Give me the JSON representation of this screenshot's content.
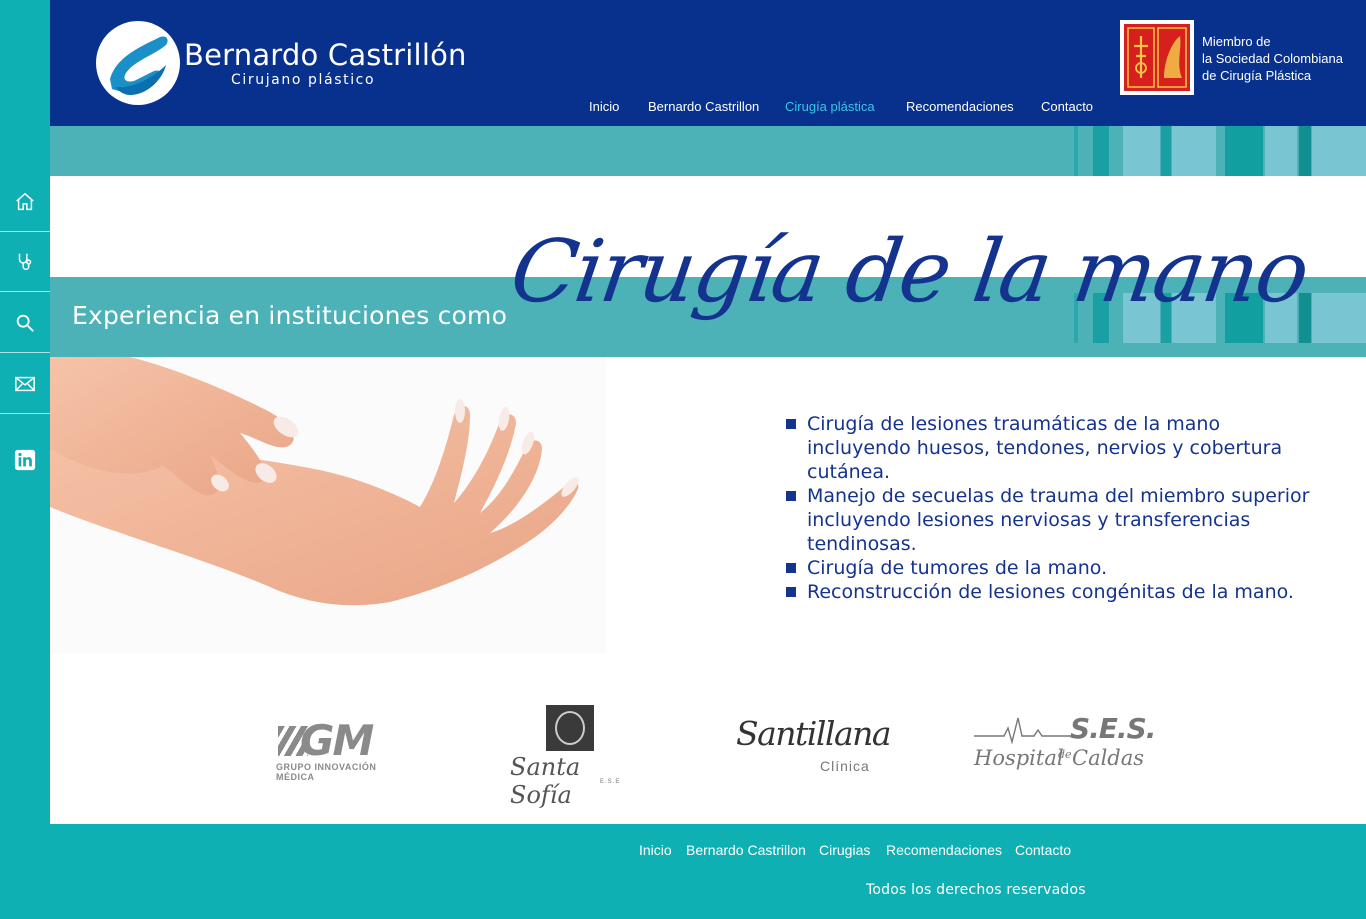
{
  "brand": {
    "name": "Bernardo Castrillón",
    "subtitle": "Cirujano plástico"
  },
  "nav": {
    "items": [
      {
        "label": "Inicio"
      },
      {
        "label": "Bernardo Castrillon"
      },
      {
        "label": "Cirugía plástica",
        "active": true
      },
      {
        "label": "Recomendaciones"
      },
      {
        "label": "Contacto"
      }
    ]
  },
  "society": {
    "line1": "Miembro de",
    "line2": "la Sociedad Colombiana",
    "line3": "de Cirugía Plástica"
  },
  "sidebar": {
    "icons": [
      "home-icon",
      "stethoscope-icon",
      "search-icon",
      "mail-icon",
      "linkedin-icon"
    ]
  },
  "hero": {
    "experience_text": "Experiencia en instituciones como",
    "title": "Cirugía de la mano"
  },
  "procedures": [
    "Cirugía de lesiones traumáticas de la mano incluyendo huesos, tendones, nervios y cobertura cutánea.",
    "Manejo de secuelas de trauma del miembro superior incluyendo lesiones nerviosas y transferencias tendinosas.",
    "Cirugía de tumores de la mano.",
    "Reconstrucción de lesiones congénitas de la mano."
  ],
  "partners": {
    "gm": {
      "mark": "GM",
      "caption": "GRUPO INNOVACIÓN MÉDICA"
    },
    "santa_sofia": {
      "name": "Santa Sofía",
      "caption": "E.S.E"
    },
    "santillana": {
      "name": "Santillana",
      "caption": "Clínica"
    },
    "ses": {
      "mark": "S.E.S.",
      "name": "Hospital",
      "de": "de",
      "place": "Caldas"
    }
  },
  "footer": {
    "nav": [
      "Inicio",
      "Bernardo Castrillon",
      "Cirugias",
      "Recomendaciones",
      "Contacto"
    ],
    "copyright": "Todos los derechos reservados"
  },
  "colors": {
    "header_blue": "#07318c",
    "teal": "#0fb0b4",
    "band_teal": "#4cb2b8",
    "title_blue": "#14338f",
    "active_link": "#38c6e8"
  }
}
